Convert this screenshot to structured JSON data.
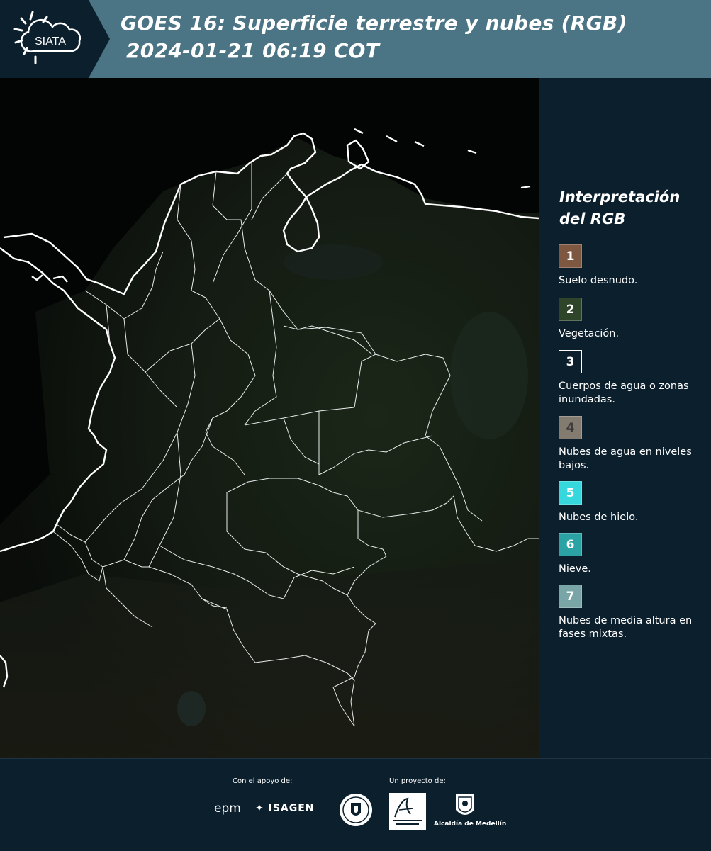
{
  "header": {
    "logo_text": "SIATA",
    "title_line1": "GOES 16: Superficie terrestre y nubes (RGB)",
    "title_line2": "2024-01-21 06:19 COT"
  },
  "legend": {
    "title_line1": "Interpretación",
    "title_line2": "del RGB",
    "items": [
      {
        "number": "1",
        "label": "Suelo desnudo.",
        "color": "#7e5741"
      },
      {
        "number": "2",
        "label": "Vegetación.",
        "color": "#2e4529"
      },
      {
        "number": "3",
        "label": "Cuerpos de agua o zonas inundadas.",
        "color": "#0c1f2d"
      },
      {
        "number": "4",
        "label": "Nubes de agua en niveles bajos.",
        "color": "#847b70"
      },
      {
        "number": "5",
        "label": "Nubes de hielo.",
        "color": "#36d8dd"
      },
      {
        "number": "6",
        "label": "Nieve.",
        "color": "#2ba3a5"
      },
      {
        "number": "7",
        "label": "Nubes de media altura en fases mixtas.",
        "color": "#7aa5a6"
      }
    ]
  },
  "footer": {
    "support_caption": "Con el apoyo de:",
    "project_caption": "Un proyecto de:",
    "epm_logo": "epm",
    "isagen_logo": "ISAGEN",
    "alcaldia_label": "Alcaldía de Medellín"
  },
  "colors": {
    "header_bg": "#4b7485",
    "logo_bg": "#0c1f2d",
    "panel_bg": "#0c1f2d",
    "map_dark": "#040606",
    "land_dark": "#121711",
    "border_line": "#ffffff"
  }
}
